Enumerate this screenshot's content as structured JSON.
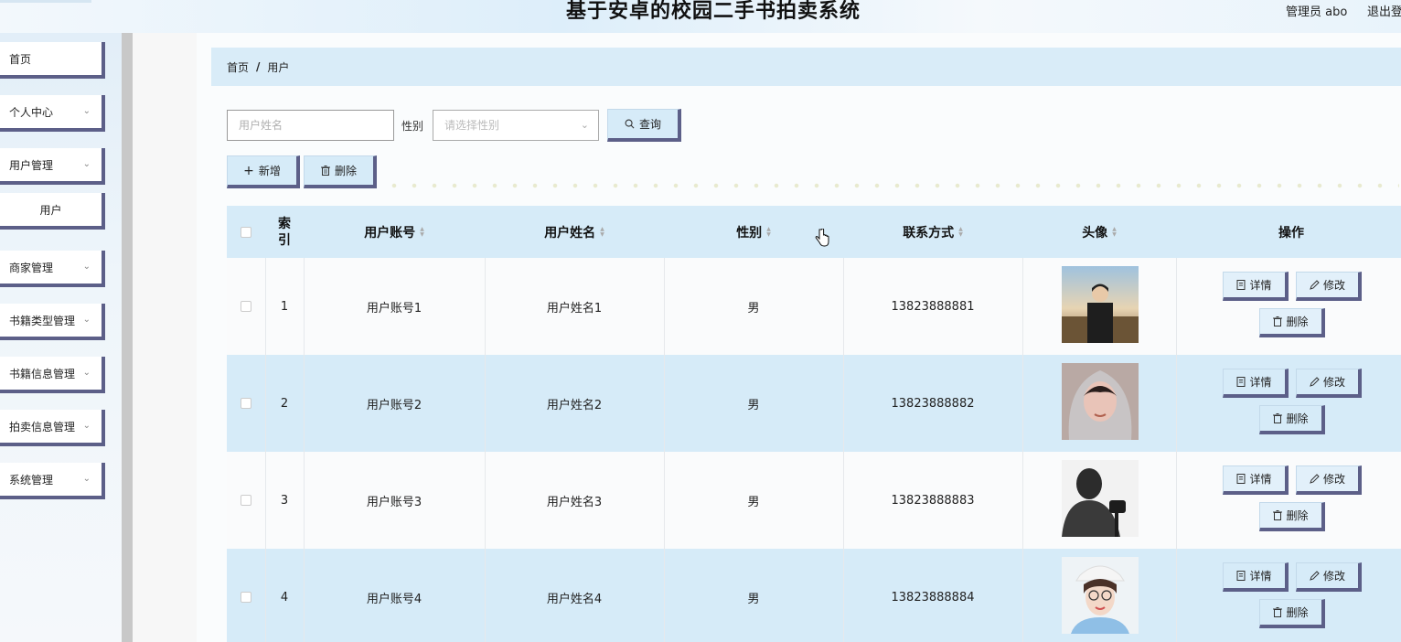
{
  "header": {
    "title": "基于安卓的校园二手书拍卖系统",
    "user": "管理员 abo",
    "logout": "退出登"
  },
  "sidebar": {
    "items": [
      {
        "label": "首页",
        "expandable": false
      },
      {
        "label": "个人中心",
        "expandable": true
      },
      {
        "label": "用户管理",
        "expandable": true
      },
      {
        "label": "用户",
        "expandable": false,
        "sub": true
      },
      {
        "label": "商家管理",
        "expandable": true
      },
      {
        "label": "书籍类型管理",
        "expandable": true
      },
      {
        "label": "书籍信息管理",
        "expandable": true
      },
      {
        "label": "拍卖信息管理",
        "expandable": true
      },
      {
        "label": "系统管理",
        "expandable": true
      }
    ]
  },
  "breadcrumb": {
    "home": "首页",
    "separator": "/",
    "current": "用户"
  },
  "search": {
    "name_placeholder": "用户姓名",
    "gender_label": "性别",
    "gender_placeholder": "请选择性别",
    "query_label": "查询"
  },
  "actions": {
    "add_label": "新增",
    "delete_label": "删除"
  },
  "table": {
    "headers": {
      "index": "索引",
      "account": "用户账号",
      "name": "用户姓名",
      "gender": "性别",
      "phone": "联系方式",
      "avatar": "头像",
      "ops": "操作"
    },
    "op_labels": {
      "detail": "详情",
      "edit": "修改",
      "delete": "删除"
    },
    "rows": [
      {
        "index": "1",
        "account": "用户账号1",
        "name": "用户姓名1",
        "gender": "男",
        "phone": "13823888881",
        "avatar": "avatar-photo-1"
      },
      {
        "index": "2",
        "account": "用户账号2",
        "name": "用户姓名2",
        "gender": "男",
        "phone": "13823888882",
        "avatar": "avatar-photo-2"
      },
      {
        "index": "3",
        "account": "用户账号3",
        "name": "用户姓名3",
        "gender": "男",
        "phone": "13823888883",
        "avatar": "avatar-photo-3"
      },
      {
        "index": "4",
        "account": "用户账号4",
        "name": "用户姓名4",
        "gender": "男",
        "phone": "13823888884",
        "avatar": "avatar-photo-4"
      }
    ]
  },
  "colors": {
    "accent_border": "#5c5f88",
    "header_bg": "#d6ebf8",
    "stripe_bg": "#d6ebf8"
  }
}
